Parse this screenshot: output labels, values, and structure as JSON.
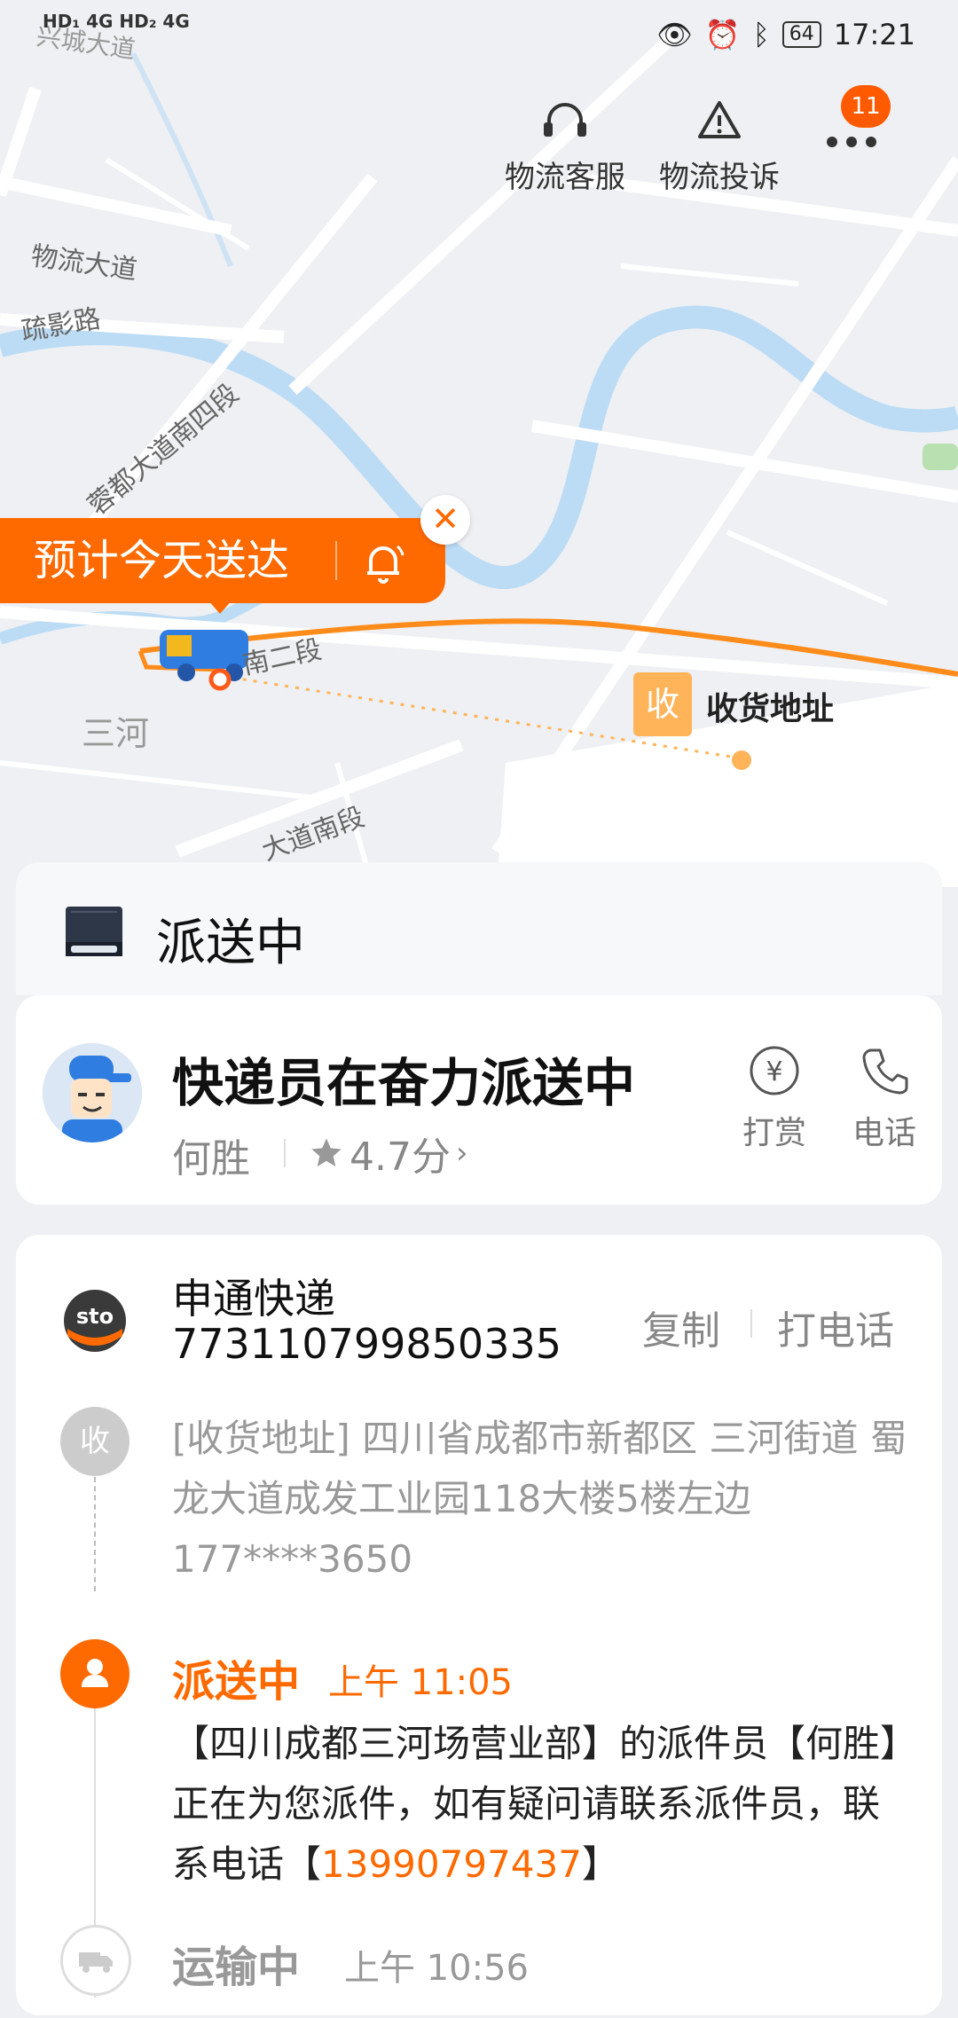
{
  "status_bar": {
    "left_indicators": "HD₁ 4G  HD₂ 4G",
    "time": "17:21",
    "battery": "64"
  },
  "top_actions": {
    "service": "物流客服",
    "complaint": "物流投诉",
    "more_badge": "11"
  },
  "map": {
    "labels": [
      "物流大道",
      "疏影路",
      "蓉都大道南四段",
      "三河",
      "大道南段",
      "南二段",
      "兴城大道"
    ],
    "eta": "预计今天送达",
    "receiver_tag": "收",
    "receiver_text": "收货地址"
  },
  "status": {
    "title": "派送中"
  },
  "courier": {
    "title": "快递员在奋力派送中",
    "name": "何胜",
    "rating": "4.7分",
    "tip_label": "打赏",
    "phone_label": "电话"
  },
  "shipment": {
    "carrier": "申通快递",
    "tracking_no": "773110799850335",
    "copy_label": "复制",
    "call_label": "打电话",
    "receiver_icon": "收",
    "address": "[收货地址] 四川省成都市新都区 三河街道   蜀龙大道成发工业园118大楼5楼左边 177****3650",
    "events": [
      {
        "title": "派送中",
        "time": "上午 11:05",
        "desc_before": "【四川成都三河场营业部】的派件员【何胜】正在为您派件，如有疑问请联系派件员，联系电话【",
        "phone": "13990797437",
        "desc_after": "】"
      },
      {
        "title": "运输中",
        "time": "上午 10:56"
      }
    ]
  },
  "colors": {
    "accent": "#ff6a00",
    "route": "#ff8c1a",
    "river": "#bcdcf5"
  }
}
